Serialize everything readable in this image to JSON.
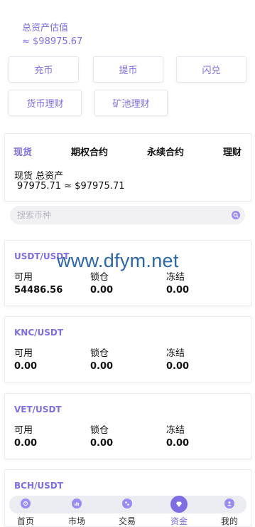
{
  "header": {
    "total_label": "总资产估值",
    "total_value": "≈ $98975.67"
  },
  "actions": {
    "deposit": "充币",
    "withdraw": "提币",
    "exchange": "闪兑",
    "coin_finance": "货币理财",
    "mining_finance": "矿池理财"
  },
  "tabs": {
    "spot": "现货",
    "options": "期权合约",
    "perpetual": "永续合约",
    "finance": "理财"
  },
  "spot_summary": {
    "title": "现货 总资产",
    "value": "97975.71 ≈ $97975.71"
  },
  "search": {
    "placeholder": "搜索币种"
  },
  "watermark": "www.dfym.net",
  "assets": [
    {
      "pair": "USDT/USDT",
      "available_label": "可用",
      "locked_label": "锁仓",
      "frozen_label": "冻结",
      "available": "54486.56",
      "locked": "0.00",
      "frozen": "0.00"
    },
    {
      "pair": "KNC/USDT",
      "available_label": "可用",
      "locked_label": "锁仓",
      "frozen_label": "冻结",
      "available": "0.00",
      "locked": "0.00",
      "frozen": "0.00"
    },
    {
      "pair": "VET/USDT",
      "available_label": "可用",
      "locked_label": "锁仓",
      "frozen_label": "冻结",
      "available": "0.00",
      "locked": "0.00",
      "frozen": "0.00"
    },
    {
      "pair": "BCH/USDT"
    }
  ],
  "nav": {
    "home": "首页",
    "market": "市场",
    "trade": "交易",
    "funds": "资金",
    "mine": "我的"
  },
  "colors": {
    "accent": "#7d6ee6",
    "accent_light": "#9a8cf2",
    "watermark": "#2b67ae"
  }
}
